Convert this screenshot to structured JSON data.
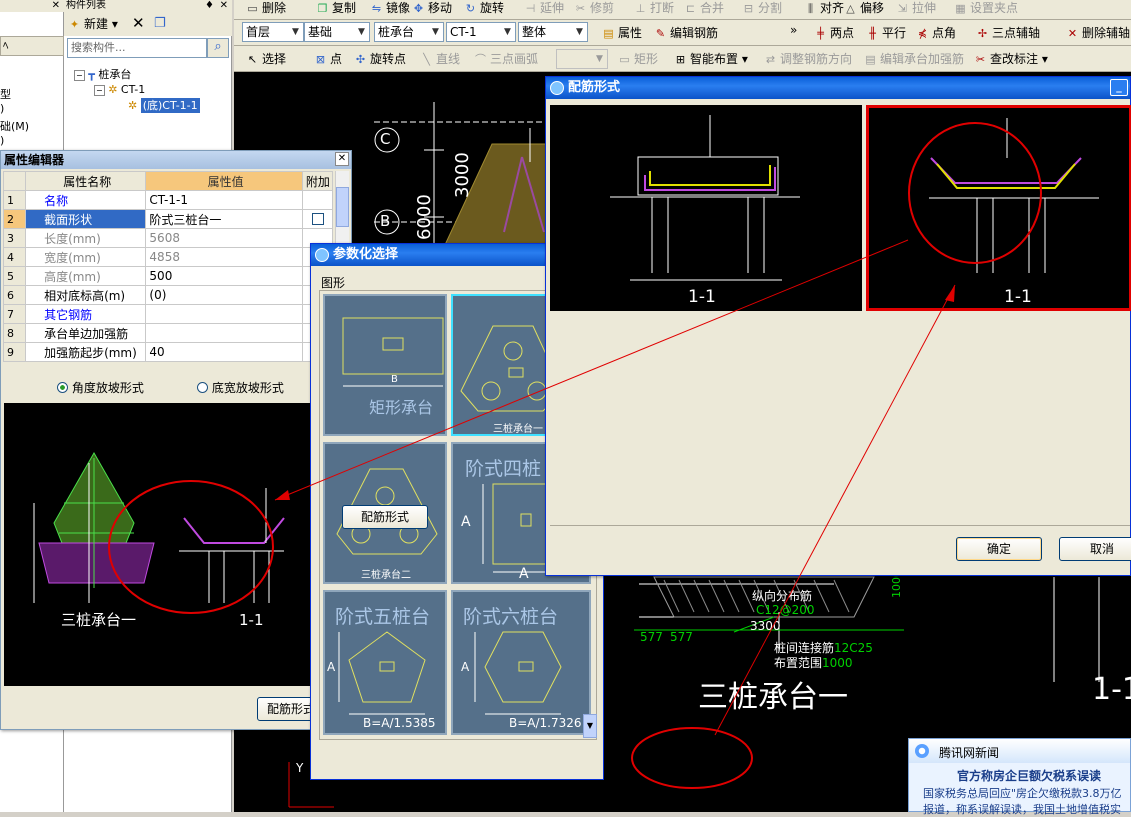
{
  "main_toolbar": {
    "delete": "删除",
    "copy": "复制",
    "mirror": "镜像",
    "move": "移动",
    "rotate": "旋转",
    "extend": "延伸",
    "trim": "修剪",
    "break": "打断",
    "merge": "合并",
    "split": "分割",
    "align": "对齐",
    "offset": "偏移",
    "stretch": "拉伸",
    "set_grip": "设置夹点"
  },
  "combos": {
    "floor": "首层",
    "category": "基础",
    "type": "桩承台",
    "element": "CT-1",
    "scope": "整体"
  },
  "toolbar2": {
    "properties": "属性",
    "edit_rebar": "编辑钢筋",
    "two_points": "两点",
    "parallel": "平行",
    "point_angle": "点角",
    "three_point_axis": "三点辅轴",
    "delete_axis": "删除辅轴"
  },
  "toolbar3": {
    "select": "选择",
    "point": "点",
    "rotate_point": "旋转点",
    "line": "直线",
    "arc": "三点画弧",
    "rect": "矩形",
    "smart_layout": "智能布置",
    "adjust_dir": "调整钢筋方向",
    "edit_pile_cap": "编辑承台加强筋",
    "view_label": "查改标注"
  },
  "component_list": {
    "title": "构件列表",
    "new": "新建",
    "search_placeholder": "搜索构件...",
    "tree": {
      "root": "桩承台",
      "child": "CT-1",
      "leaf": "(底)CT-1-1"
    }
  },
  "left_panel": {
    "tab": "ﾍ",
    "items": [
      "型",
      ")",
      "础(M)",
      ")"
    ]
  },
  "prop_editor": {
    "title": "属性编辑器",
    "headers": [
      "属性名称",
      "属性值",
      "附加"
    ],
    "rows": [
      {
        "n": "1",
        "name": "名称",
        "value": "CT-1-1"
      },
      {
        "n": "2",
        "name": "截面形状",
        "value": "阶式三桩台一"
      },
      {
        "n": "3",
        "name": "长度(mm)",
        "value": "5608"
      },
      {
        "n": "4",
        "name": "宽度(mm)",
        "value": "4858"
      },
      {
        "n": "5",
        "name": "高度(mm)",
        "value": "500"
      },
      {
        "n": "6",
        "name": "相对底标高(m)",
        "value": "(0)"
      },
      {
        "n": "7",
        "name": "其它钢筋",
        "value": ""
      },
      {
        "n": "8",
        "name": "承台单边加强筋",
        "value": ""
      },
      {
        "n": "9",
        "name": "加强筋起步(mm)",
        "value": "40"
      }
    ],
    "radio1": "角度放坡形式",
    "radio2": "底宽放坡形式",
    "preview_label1": "三桩承台一",
    "preview_label2": "1-1",
    "button": "配筋形式"
  },
  "param_dialog": {
    "title": "参数化选择",
    "group": "图形",
    "tiles": [
      "矩形承台",
      "三桩承台一",
      "三桩承台二",
      "阶式四桩",
      "阶式五桩台",
      "阶式六桩台"
    ],
    "dims": {
      "b": "B",
      "a": "A",
      "b5": "B=A/1.5385",
      "b6": "B=A/1.7326"
    },
    "button": "配筋形式"
  },
  "rebar_dialog": {
    "title": "配筋形式",
    "left_label": "1-1",
    "right_label": "1-1",
    "ok": "确定",
    "cancel": "取消"
  },
  "cad": {
    "axis_c": "C",
    "axis_b": "B",
    "dim1": "3000",
    "dim2": "6000",
    "label_long": "纵向分布筋",
    "label_c": "C12@200",
    "dims_bottom": [
      "577",
      "577",
      "3300"
    ],
    "label_pile": "桩间连接筋",
    "label_pile_val": "12C25",
    "label_range": "布置范围",
    "label_range_val": "1000",
    "big_label": "三桩承台一",
    "big_label2": "1-1",
    "dim_right": "1000"
  },
  "news": {
    "source": "腾讯网新闻",
    "headline": "官方称房企巨额欠税系误读",
    "body": "国家税务总局回应\"房企欠缴税款3.8万亿",
    "body2": "报道，称系误解误读，我国土地增值税实"
  },
  "colors": {
    "cad_bg": "#000000",
    "title_blue": "#0a5fd8",
    "highlight_red": "#e00000",
    "tile_bg": "#55708a"
  }
}
